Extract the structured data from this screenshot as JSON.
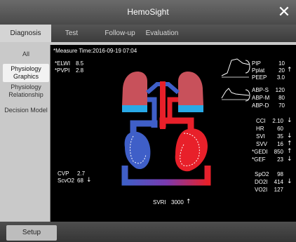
{
  "app": {
    "title": "HemoSight"
  },
  "tabs": [
    {
      "label": "Diagnosis",
      "active": true
    },
    {
      "label": "Test",
      "active": false
    },
    {
      "label": "Follow-up",
      "active": false
    },
    {
      "label": "Evaluation",
      "active": false
    }
  ],
  "sidebar": {
    "items": [
      {
        "label": "All",
        "active": false
      },
      {
        "label": "Physiology Graphics",
        "active": true
      },
      {
        "label": "Physiology Relationship",
        "active": false
      },
      {
        "label": "Decision Model",
        "active": false
      }
    ]
  },
  "panel": {
    "measure_time": "*Measure Time:2016-09-19 07:04",
    "left_params": [
      {
        "label": "*ELWI",
        "value": "8.5",
        "arrow": ""
      },
      {
        "label": "*PVPI",
        "value": "2.8",
        "arrow": ""
      }
    ],
    "bottom_left_params": [
      {
        "label": "CVP",
        "value": "2.7",
        "arrow": ""
      },
      {
        "label": "ScvO2",
        "value": "68",
        "arrow": "↓"
      }
    ],
    "pressure_params": [
      {
        "label": "PIP",
        "value": "10",
        "arrow": ""
      },
      {
        "label": "Pplat",
        "value": "20",
        "arrow": "↑"
      },
      {
        "label": "PEEP",
        "value": "3.0",
        "arrow": ""
      }
    ],
    "abp_params": [
      {
        "label": "ABP-S",
        "value": "120",
        "arrow": ""
      },
      {
        "label": "ABP-M",
        "value": "80",
        "arrow": ""
      },
      {
        "label": "ABP-D",
        "value": "70",
        "arrow": ""
      }
    ],
    "cardiac_params": [
      {
        "label": "CCI",
        "value": "2.10",
        "arrow": "↓"
      },
      {
        "label": "HR",
        "value": "60",
        "arrow": ""
      },
      {
        "label": "SVI",
        "value": "35",
        "arrow": "↓"
      },
      {
        "label": "SVV",
        "value": "16",
        "arrow": "↑"
      },
      {
        "label": "*GEDI",
        "value": "850",
        "arrow": "↑"
      },
      {
        "label": "*GEF",
        "value": "23",
        "arrow": "↓"
      }
    ],
    "oxygen_params": [
      {
        "label": "SpO2",
        "value": "98",
        "arrow": ""
      },
      {
        "label": "DO2I",
        "value": "414",
        "arrow": "↓"
      },
      {
        "label": "VO2I",
        "value": "127",
        "arrow": ""
      }
    ],
    "svri": {
      "label": "SVRI",
      "value": "3000",
      "arrow": "↑"
    }
  },
  "footer": {
    "setup_label": "Setup"
  },
  "colors": {
    "lung_red": "#c8515b",
    "lung_blue": "#29a9e6",
    "artery_red": "#e8202a",
    "vein_blue": "#3f5fc8",
    "panel_bg": "#000000"
  },
  "icons": [
    "close-icon",
    "pressure-waveform-icon",
    "abp-waveform-icon",
    "up-arrow-icon",
    "down-arrow-icon"
  ]
}
